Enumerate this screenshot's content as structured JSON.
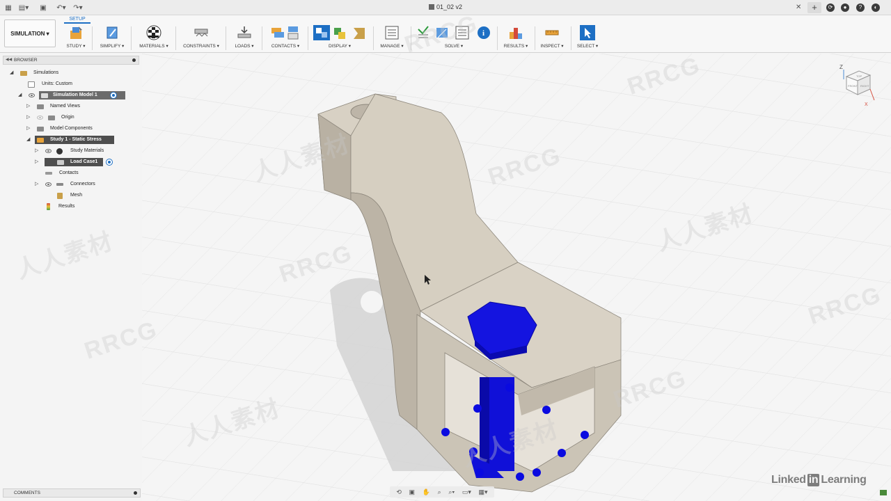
{
  "window": {
    "doc_title": "01_02 v2"
  },
  "toolbar": {
    "workspace_label": "SIMULATION ▾",
    "active_tab": "SETUP",
    "tools": [
      {
        "label": "STUDY ▾"
      },
      {
        "label": "SIMPLIFY ▾"
      },
      {
        "label": "MATERIALS ▾"
      },
      {
        "label": "CONSTRAINTS ▾"
      },
      {
        "label": "LOADS ▾"
      },
      {
        "label": "CONTACTS ▾"
      },
      {
        "label": "DISPLAY ▾"
      },
      {
        "label": "MANAGE ▾"
      },
      {
        "label": "SOLVE ▾"
      },
      {
        "label": "RESULTS ▾"
      },
      {
        "label": "INSPECT ▾"
      },
      {
        "label": "SELECT ▾"
      }
    ]
  },
  "browser": {
    "title": "BROWSER",
    "items": [
      {
        "label": "Simulations"
      },
      {
        "label": "Units: Custom"
      },
      {
        "label": "Simulation Model 1"
      },
      {
        "label": "Named Views"
      },
      {
        "label": "Origin"
      },
      {
        "label": "Model Components"
      },
      {
        "label": "Study 1 - Static Stress"
      },
      {
        "label": "Study Materials"
      },
      {
        "label": "Load Case1"
      },
      {
        "label": "Contacts"
      },
      {
        "label": "Connectors"
      },
      {
        "label": "Mesh"
      },
      {
        "label": "Results"
      }
    ]
  },
  "comments": {
    "title": "COMMENTS"
  },
  "viewcube": {
    "z_label": "Z",
    "x_label": "X",
    "front_label": "FRONT",
    "right_label": "RIGHT",
    "top_label": "TOP"
  },
  "watermarks": {
    "rrcg": "RRCG",
    "cn": "人人素材"
  },
  "branding": {
    "linkedin_pre": "Linked",
    "linkedin_in": "in",
    "linkedin_post": "Learning"
  },
  "colors": {
    "accent": "#1d6fc4",
    "part": "#cfc8bb",
    "bolt": "#1010d8"
  }
}
